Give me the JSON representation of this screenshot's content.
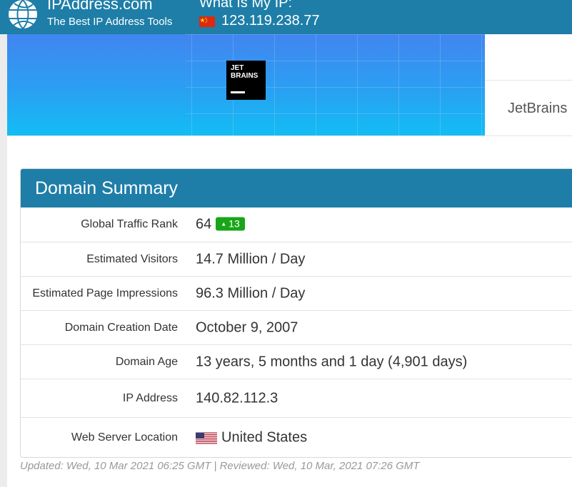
{
  "header": {
    "brand_title": "IPAddress.com",
    "brand_tagline": "The Best IP Address Tools",
    "myip_label": "What Is My IP:",
    "myip_value": "123.119.238.77",
    "bar_color": "#1e7ea8"
  },
  "banner": {
    "logo_text": "JET\nBRAINS",
    "side_name": "JetBrains"
  },
  "summary": {
    "title": "Domain Summary",
    "rows": [
      {
        "label": "Global Traffic Rank",
        "value": "64",
        "badge": "13",
        "badge_color": "#18a518"
      },
      {
        "label": "Estimated Visitors",
        "value": "14.7 Million / Day"
      },
      {
        "label": "Estimated Page Impressions",
        "value": "96.3 Million / Day"
      },
      {
        "label": "Domain Creation Date",
        "value": "October 9, 2007"
      },
      {
        "label": "Domain Age",
        "value": "13 years, 5 months and 1 day (4,901 days)"
      },
      {
        "label": "IP Address",
        "value": "140.82.112.3"
      },
      {
        "label": "Web Server Location",
        "value": "United States",
        "flag_icon": "us-flag-icon"
      }
    ]
  },
  "footer": {
    "note": "Updated: Wed, 10 Mar 2021 06:25 GMT | Reviewed: Wed, 10 Mar, 2021 07:26 GMT"
  }
}
